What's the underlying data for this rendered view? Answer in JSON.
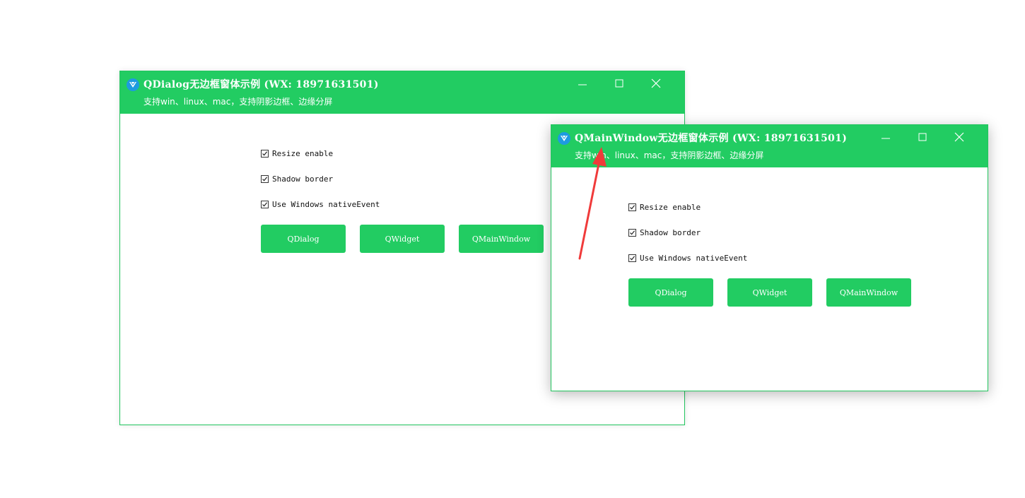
{
  "windows": [
    {
      "id": "dialog",
      "title": "QDialog无边框窗体示例 (WX: 18971631501)",
      "subtitle": "支持win、linux、mac，支持阴影边框、边缘分屏",
      "options": [
        {
          "label": "Resize enable",
          "checked": true
        },
        {
          "label": "Shadow border",
          "checked": true
        },
        {
          "label": "Use Windows nativeEvent",
          "checked": true
        }
      ],
      "buttons": [
        "QDialog",
        "QWidget",
        "QMainWindow"
      ]
    },
    {
      "id": "mainwindow",
      "title": "QMainWindow无边框窗体示例 (WX: 18971631501)",
      "subtitle": "支持win、linux、mac，支持阴影边框、边缘分屏",
      "options": [
        {
          "label": "Resize enable",
          "checked": true
        },
        {
          "label": "Shadow border",
          "checked": true
        },
        {
          "label": "Use Windows nativeEvent",
          "checked": true
        }
      ],
      "buttons": [
        "QDialog",
        "QWidget",
        "QMainWindow"
      ]
    }
  ],
  "icons": {
    "app": "app-logo-icon",
    "minimize": "minimize-icon",
    "maximize": "maximize-icon",
    "close": "close-icon",
    "checkbox": "checkmark-icon",
    "annotation": "red-arrow-annotation"
  },
  "colors": {
    "accent": "#22cc62",
    "border": "#22c55e",
    "app_icon": "#1e9be0",
    "annotation": "#f03a3a"
  }
}
